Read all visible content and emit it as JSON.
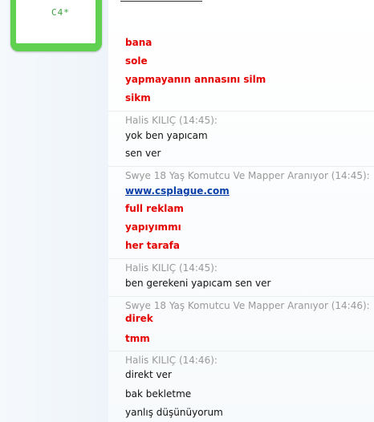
{
  "avatar": {
    "label": "C4*"
  },
  "messages": {
    "m1": "bana",
    "m2": "sole",
    "m3": "yapmayanın annasını silm",
    "m4": "sikm",
    "h1": "Halis KILIÇ (14:45):",
    "m5": "yok ben yapıcam",
    "m6": "sen ver",
    "h2": "Swye 18 Yaş Komutcu Ve Mapper Aranıyor (14:45):",
    "m7": "www.csplague.com",
    "m8": "full reklam",
    "m9": "yapıyımmı",
    "m10": "her tarafa",
    "h3": "Halis KILIÇ (14:45):",
    "m11": "ben gerekeni yapıcam sen ver",
    "h4": "Swye 18 Yaş Komutcu Ve Mapper Aranıyor (14:46):",
    "m12": "direk",
    "m13": "tmm",
    "h5": "Halis KILIÇ (14:46):",
    "m14": "direkt ver",
    "m15": "bak bekletme",
    "m16": "yanlış düşünüyorum"
  }
}
